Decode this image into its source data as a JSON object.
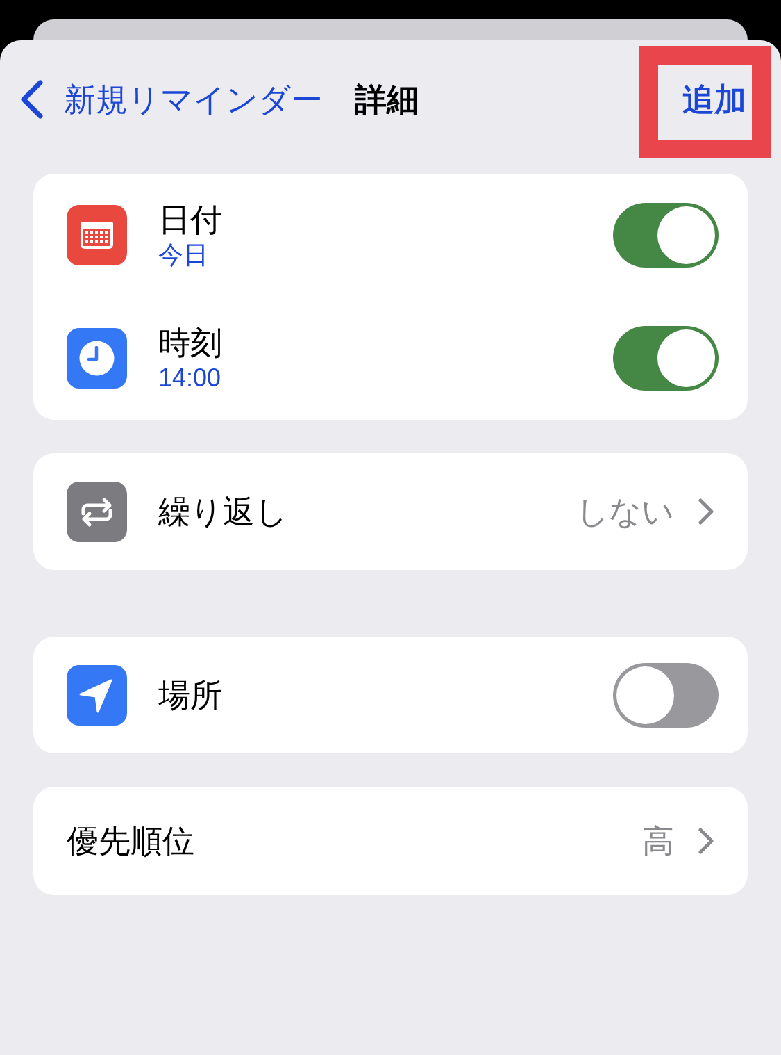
{
  "nav": {
    "back_label": "新規リマインダー",
    "title": "詳細",
    "action": {
      "label": "追加",
      "highlighted": true
    }
  },
  "groups": [
    {
      "rows": [
        {
          "kind": "toggle",
          "title": "日付",
          "subtitle": "今日",
          "on": true
        },
        {
          "kind": "toggle",
          "title": "時刻",
          "subtitle": "14:00",
          "on": true
        }
      ]
    },
    {
      "rows": [
        {
          "kind": "value",
          "title": "繰り返し",
          "value": "しない"
        }
      ]
    },
    {
      "rows": [
        {
          "kind": "toggle",
          "title": "場所",
          "on": false
        }
      ]
    },
    {
      "rows": [
        {
          "kind": "value",
          "title": "優先順位",
          "value": "高"
        }
      ]
    }
  ]
}
